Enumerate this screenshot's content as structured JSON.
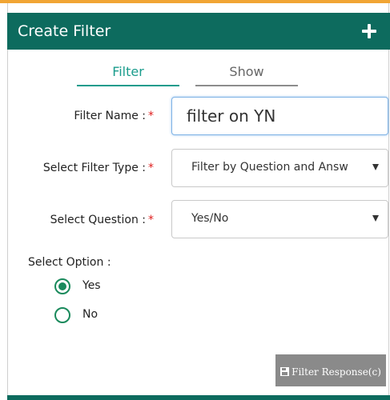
{
  "header": {
    "title": "Create Filter"
  },
  "tabs": [
    {
      "label": "Filter",
      "active": true
    },
    {
      "label": "Show",
      "active": false
    }
  ],
  "form": {
    "filter_name": {
      "label": "Filter Name :",
      "required_mark": "*",
      "value": "filter on YN"
    },
    "filter_type": {
      "label": "Select Filter Type :",
      "required_mark": "*",
      "value": "Filter by Question and Answ"
    },
    "question": {
      "label": "Select Question :",
      "required_mark": "*",
      "value": "Yes/No"
    },
    "option": {
      "label": "Select Option :",
      "choices": [
        {
          "label": "Yes",
          "selected": true
        },
        {
          "label": "No",
          "selected": false
        }
      ]
    }
  },
  "footer": {
    "submit_label": "Filter Response(c)",
    "submit_icon": "save-disk-icon"
  },
  "colors": {
    "header": "#0d6b5e",
    "accent": "#1a9c8c",
    "radio": "#1a8a5c",
    "required": "#e02020",
    "top_border": "#f1a534"
  }
}
